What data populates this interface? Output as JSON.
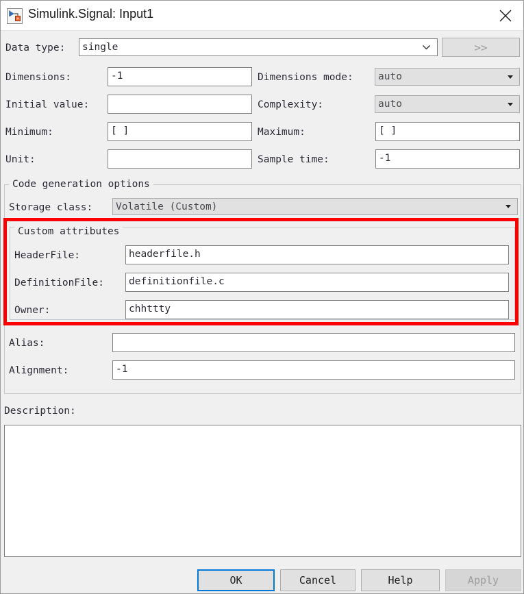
{
  "window": {
    "title": "Simulink.Signal: Input1",
    "icon": "simulink-signal-icon",
    "close_icon": "close-icon"
  },
  "fields": {
    "data_type": {
      "label": "Data type:",
      "value": "single",
      "more_button": ">>"
    },
    "dimensions": {
      "label": "Dimensions:",
      "value": "-1"
    },
    "dimensions_mode": {
      "label": "Dimensions mode:",
      "value": "auto"
    },
    "initial_value": {
      "label": "Initial value:",
      "value": ""
    },
    "complexity": {
      "label": "Complexity:",
      "value": "auto"
    },
    "minimum": {
      "label": "Minimum:",
      "value": "[ ]"
    },
    "maximum": {
      "label": "Maximum:",
      "value": "[ ]"
    },
    "unit": {
      "label": "Unit:",
      "value": ""
    },
    "sample_time": {
      "label": "Sample time:",
      "value": "-1"
    }
  },
  "code_generation": {
    "group_title": "Code generation options",
    "storage_class": {
      "label": "Storage class:",
      "value": "Volatile (Custom)"
    },
    "custom_attributes": {
      "group_title": "Custom attributes",
      "header_file": {
        "label": "HeaderFile:",
        "value": "headerfile.h"
      },
      "definition_file": {
        "label": "DefinitionFile:",
        "value": "definitionfile.c"
      },
      "owner": {
        "label": "Owner:",
        "value": "chhttty"
      }
    },
    "alias": {
      "label": "Alias:",
      "value": ""
    },
    "alignment": {
      "label": "Alignment:",
      "value": "-1"
    }
  },
  "description": {
    "label": "Description:",
    "value": ""
  },
  "buttons": {
    "ok": "OK",
    "cancel": "Cancel",
    "help": "Help",
    "apply": "Apply"
  },
  "colors": {
    "annotation": "#ff0000",
    "focus": "#0078d7",
    "dialog_bg": "#f0f0f0"
  }
}
